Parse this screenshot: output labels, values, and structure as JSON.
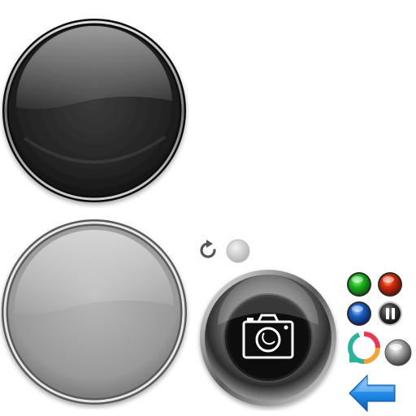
{
  "sprites": {
    "large_dark_button": {
      "kind": "glossy-round-button",
      "state": "normal",
      "color": "#1e1e1e"
    },
    "large_light_button": {
      "kind": "glossy-round-button",
      "state": "disabled",
      "color": "#9a9a9a"
    },
    "camera_button": {
      "kind": "shutter-button",
      "icon": "camera-icon",
      "color": "#111111"
    },
    "small_buttons": [
      {
        "name": "refresh",
        "icon": "refresh-icon",
        "color": "#555555"
      },
      {
        "name": "gray-dot",
        "icon": "dot-icon",
        "color": "#c8c8c8"
      },
      {
        "name": "green",
        "icon": "green-led-icon",
        "color": "#19b51c"
      },
      {
        "name": "red",
        "icon": "red-led-icon",
        "color": "#d32a0a"
      },
      {
        "name": "blue",
        "icon": "blue-led-icon",
        "color": "#1b5fc4"
      },
      {
        "name": "pause",
        "icon": "pause-icon",
        "color": "#3a3a3a"
      },
      {
        "name": "loading-ring",
        "icon": "loading-ring-icon",
        "colors": [
          "#e8384f",
          "#f2a33a",
          "#2bb39b"
        ]
      },
      {
        "name": "silver",
        "icon": "silver-ball-icon",
        "color": "#8a8a8a"
      },
      {
        "name": "back-arrow",
        "icon": "arrow-left-icon",
        "color": "#1e88e5"
      }
    ]
  }
}
